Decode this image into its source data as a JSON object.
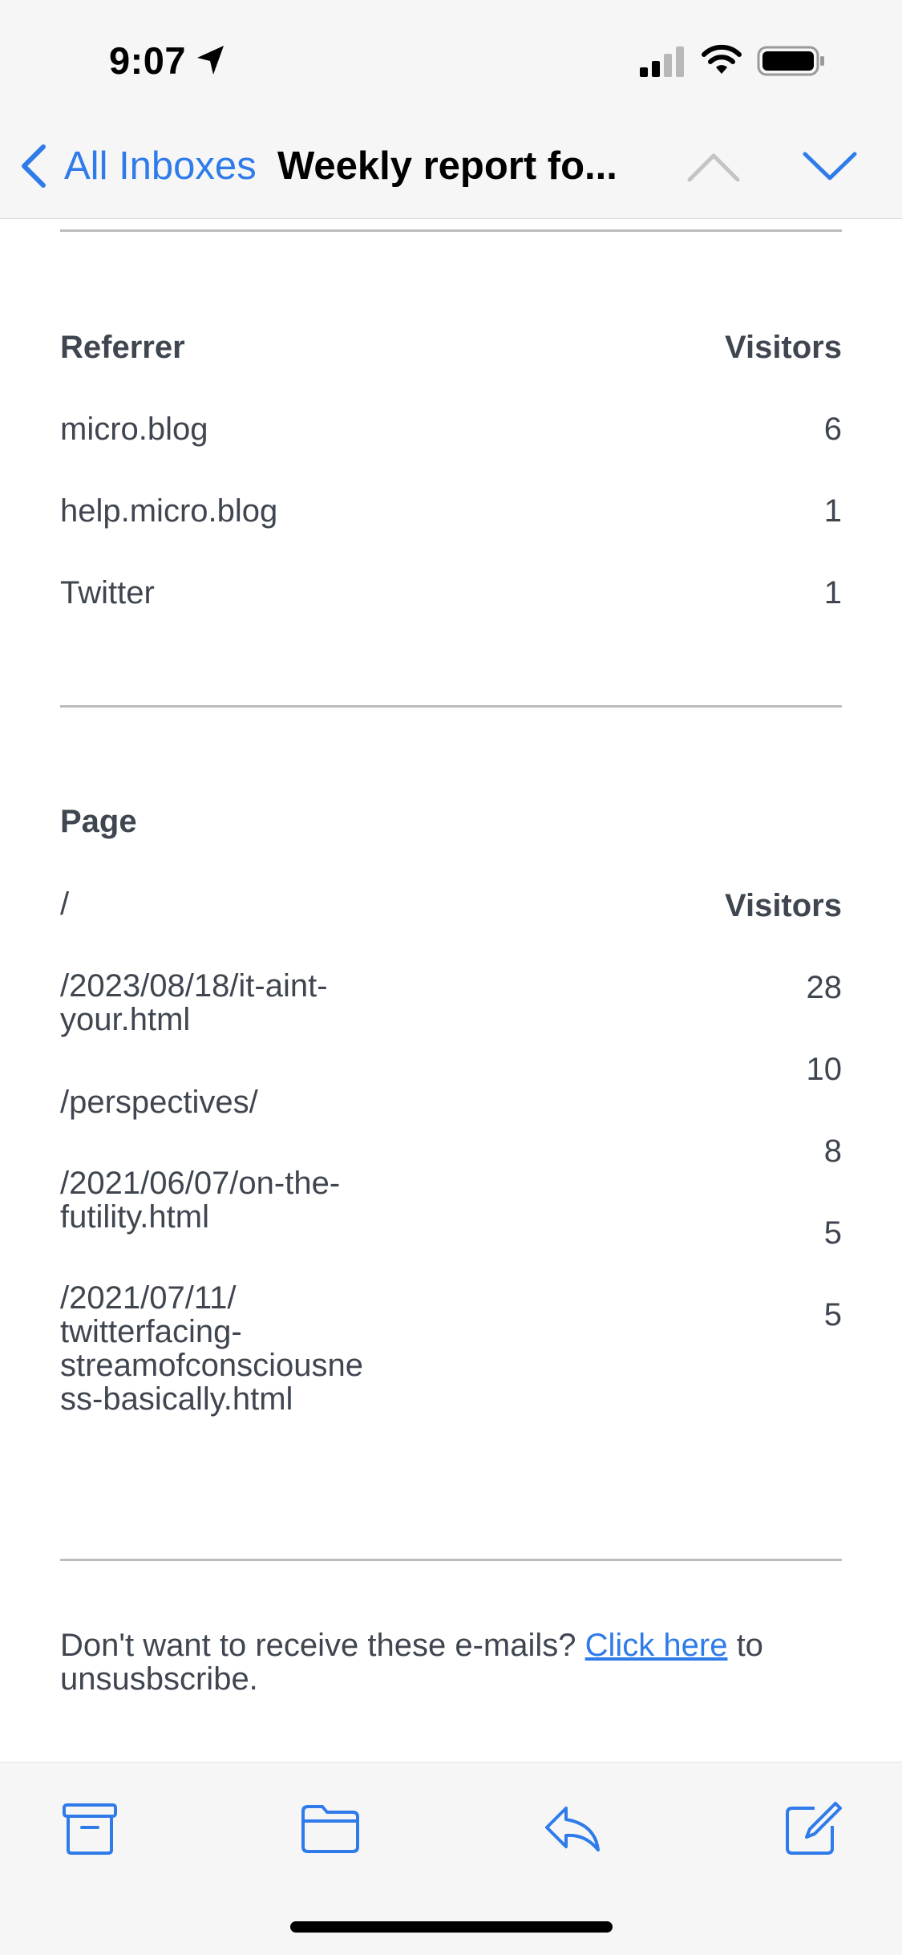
{
  "status_bar": {
    "time": "9:07",
    "icons": [
      "location-arrow-icon",
      "cellular-signal-icon",
      "wifi-icon",
      "battery-icon"
    ]
  },
  "nav": {
    "back_label": "All Inboxes",
    "title": "Weekly report fo...",
    "accent_color": "#2f7bea"
  },
  "referrer_table": {
    "headers": {
      "referrer": "Referrer",
      "visitors": "Visitors"
    },
    "rows": [
      {
        "referrer": "micro.blog",
        "visitors": "6"
      },
      {
        "referrer": "help.micro.blog",
        "visitors": "1"
      },
      {
        "referrer": "Twitter",
        "visitors": "1"
      }
    ]
  },
  "page_table": {
    "headers": {
      "page": "Page",
      "visitors": "Visitors"
    },
    "pages": [
      "/",
      "/2023/08/18/it-aint-\nyour.html",
      "/perspectives/",
      "/2021/06/07/on-the-\nfutility.html",
      "/2021/07/11/\ntwitterfacing-\nstreamofconsciousne\nss-basically.html"
    ],
    "visitors": [
      "28",
      "10",
      "8",
      "5",
      "5"
    ]
  },
  "footer": {
    "text_before": "Don't want to receive these e-mails? ",
    "link_text": "Click here",
    "text_after": " to unsusbscribe."
  },
  "toolbar": {
    "icons": [
      "archive-icon",
      "folder-icon",
      "reply-icon",
      "compose-icon"
    ]
  }
}
